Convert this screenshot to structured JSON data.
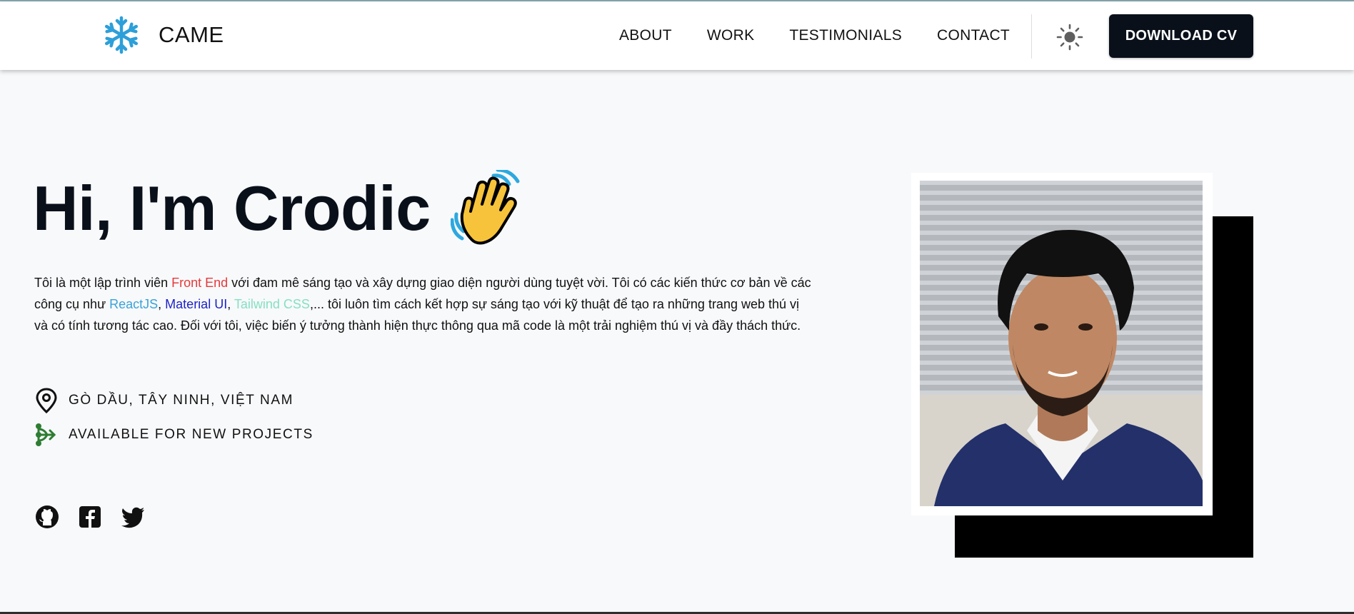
{
  "brand": {
    "name": "CAME",
    "logo_icon": "snowflake-icon",
    "accent": "#2d9fd9"
  },
  "nav": {
    "items": [
      {
        "label": "ABOUT"
      },
      {
        "label": "WORK"
      },
      {
        "label": "TESTIMONIALS"
      },
      {
        "label": "CONTACT"
      }
    ],
    "theme_toggle_icon": "sun-icon",
    "cta_label": "DOWNLOAD CV"
  },
  "hero": {
    "title": "Hi, I'm Crodic",
    "title_emoji_icon": "waving-hand-icon",
    "bio": {
      "part1": "Tôi là một lập trình viên ",
      "front_end": "Front End",
      "part2": " với đam mê sáng tạo và xây dựng giao diện người dùng tuyệt vời. Tôi có các kiến thức cơ bản về các công cụ như ",
      "reactjs": "ReactJS",
      "sep1": ", ",
      "material_ui": "Material UI",
      "sep2": ", ",
      "tailwind": "Tailwind CSS",
      "part3": ",... tôi luôn tìm cách kết hợp sự sáng tạo với kỹ thuật để tạo ra những trang web thú vị và có tính tương tác cao. Đối với tôi, việc biến ý tưởng thành hiện thực thông qua mã code là một trải nghiệm thú vị và đầy thách thức."
    },
    "location": "GÒ DẦU, TÂY NINH, VIỆT NAM",
    "availability": "AVAILABLE FOR NEW PROJECTS",
    "socials": [
      "github-icon",
      "facebook-icon",
      "twitter-icon"
    ]
  },
  "colors": {
    "front_end": "#e63a3a",
    "reactjs": "#39a2d8",
    "material_ui": "#1d22c6",
    "tailwind": "#86e0c1",
    "available": "#2e7d32"
  }
}
